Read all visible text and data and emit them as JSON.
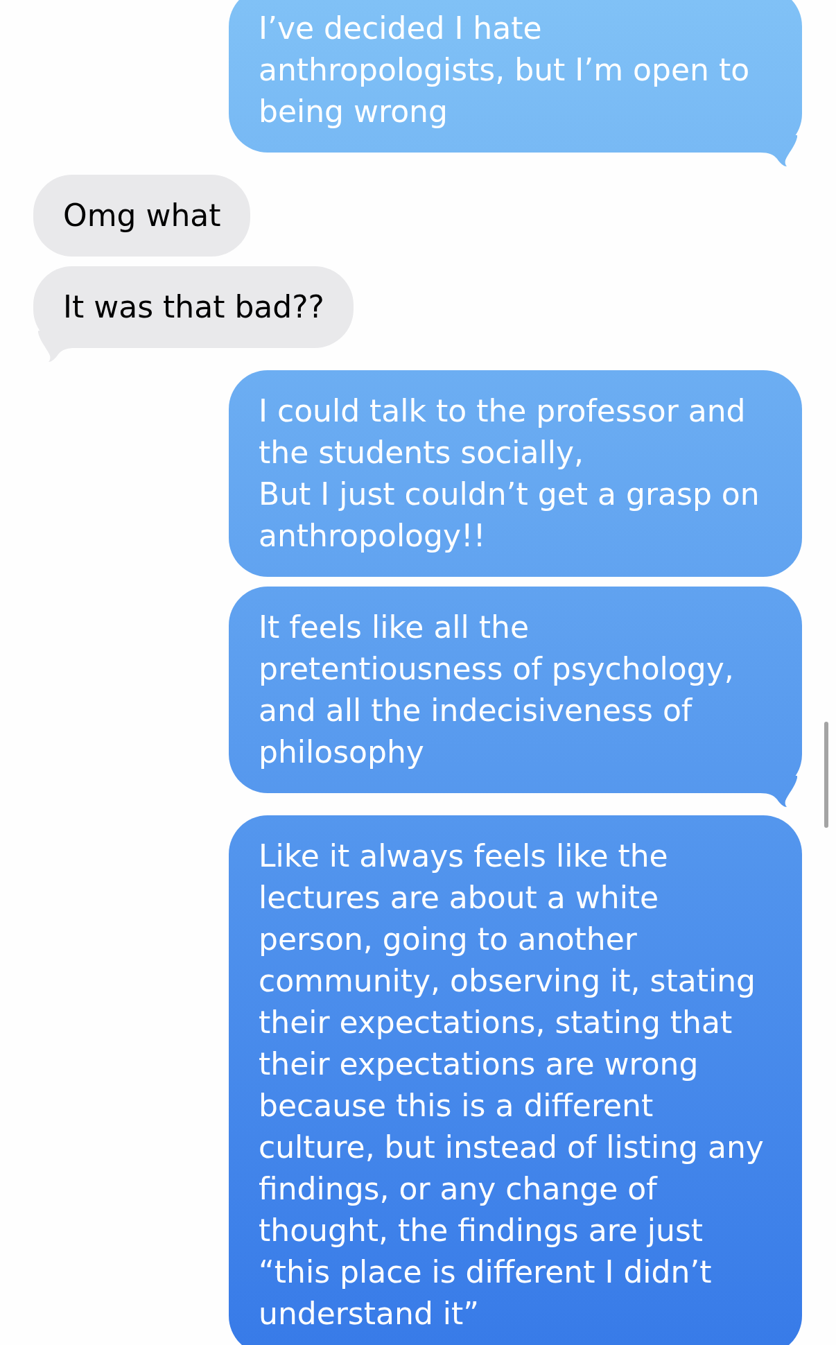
{
  "messages": [
    {
      "kind": "sent",
      "text": "I’ve decided I hate anthropologists, but I’m open to being wrong",
      "tail": true
    },
    {
      "kind": "received",
      "text": "Omg what",
      "tail": false
    },
    {
      "kind": "received",
      "text": "It was that bad??",
      "tail": true
    },
    {
      "kind": "sent",
      "text": "I could talk to the professor and the students socially,\nBut I just couldn’t get a grasp on anthropology!!",
      "tail": false
    },
    {
      "kind": "sent",
      "text": "It feels like all the pretentiousness of psychology, and all the indecisiveness of philosophy",
      "tail": true
    },
    {
      "kind": "sent",
      "text": "Like it always feels like the lectures are about a white person, going to another community, observing it, stating their expectations, stating that their expectations are wrong because this is a different culture, but instead of listing any findings, or any change of thought, the findings are just “this place is different I didn’t understand it”",
      "tail": false
    }
  ]
}
